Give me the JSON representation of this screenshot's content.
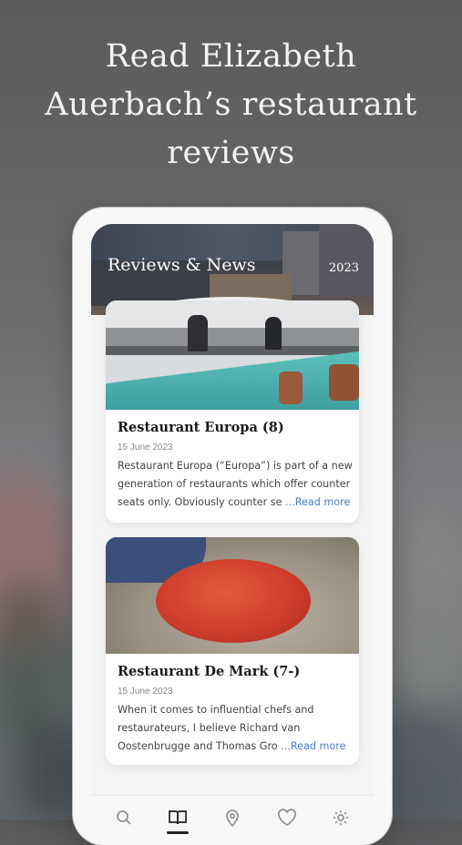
{
  "headline": {
    "line1": "Read Elizabeth",
    "line2": "Auerbach’s restaurant",
    "line3": "reviews"
  },
  "app": {
    "header_title": "Reviews & News",
    "header_year": "2023"
  },
  "reviews": [
    {
      "title": "Restaurant Europa (8)",
      "date": "15 June 2023",
      "excerpt_line1": "Restaurant Europa (“Europa”) is part of a new",
      "excerpt_line2": "generation of restaurants which offer counter",
      "excerpt_line3": "seats only. Obviously counter se",
      "read_more": "...Read more"
    },
    {
      "title": "Restaurant De Mark (7-)",
      "date": "15 June 2023",
      "excerpt_line1": "When it comes to influential chefs and",
      "excerpt_line2": "restaurateurs, I believe Richard van",
      "excerpt_line3": "Oostenbrugge and Thomas Gro",
      "read_more": "...Read more"
    }
  ],
  "tabs": [
    {
      "icon": "search-icon",
      "active": false
    },
    {
      "icon": "book-icon",
      "active": true
    },
    {
      "icon": "location-pin-icon",
      "active": false
    },
    {
      "icon": "heart-icon",
      "active": false
    },
    {
      "icon": "gear-icon",
      "active": false
    }
  ],
  "colors": {
    "accent_link": "#4a7cc9",
    "active_tab": "#222222",
    "inactive_tab": "#8a8a8a"
  }
}
